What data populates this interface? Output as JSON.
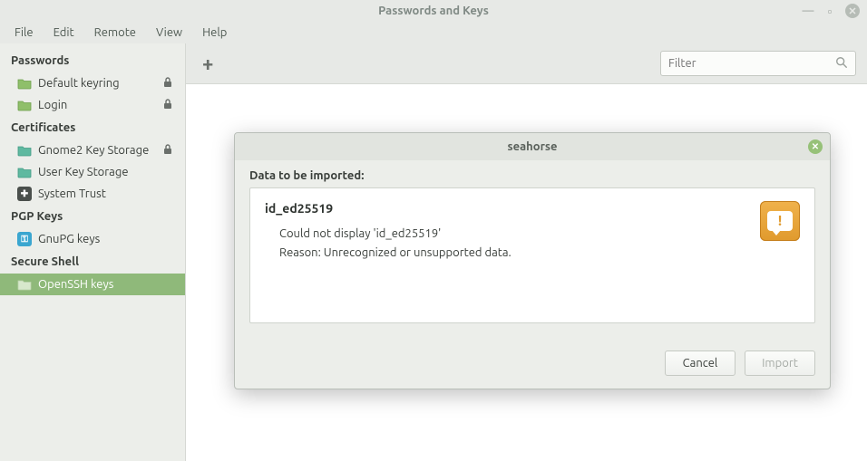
{
  "window": {
    "title": "Passwords and Keys"
  },
  "menubar": [
    "File",
    "Edit",
    "Remote",
    "View",
    "Help"
  ],
  "toolbar": {
    "add_glyph": "+",
    "filter_placeholder": "Filter"
  },
  "sidebar": {
    "groups": [
      {
        "header": "Passwords",
        "items": [
          {
            "label": "Default keyring",
            "icon": "folder-green",
            "locked": true,
            "selected": false
          },
          {
            "label": "Login",
            "icon": "folder-green",
            "locked": true,
            "selected": false
          }
        ]
      },
      {
        "header": "Certificates",
        "items": [
          {
            "label": "Gnome2 Key Storage",
            "icon": "folder-teal",
            "locked": true,
            "selected": false
          },
          {
            "label": "User Key Storage",
            "icon": "folder-teal",
            "locked": false,
            "selected": false
          },
          {
            "label": "System Trust",
            "icon": "trust",
            "locked": false,
            "selected": false
          }
        ]
      },
      {
        "header": "PGP Keys",
        "items": [
          {
            "label": "GnuPG keys",
            "icon": "key-blue",
            "locked": false,
            "selected": false
          }
        ]
      },
      {
        "header": "Secure Shell",
        "items": [
          {
            "label": "OpenSSH keys",
            "icon": "folder-gray",
            "locked": false,
            "selected": true
          }
        ]
      }
    ]
  },
  "dialog": {
    "title": "seahorse",
    "label": "Data to be imported:",
    "item": "id_ed25519",
    "message_line1": "Could not display 'id_ed25519'",
    "message_line2": "Reason:  Unrecognized or unsupported data.",
    "warn_glyph": "!",
    "cancel": "Cancel",
    "import": "Import"
  }
}
